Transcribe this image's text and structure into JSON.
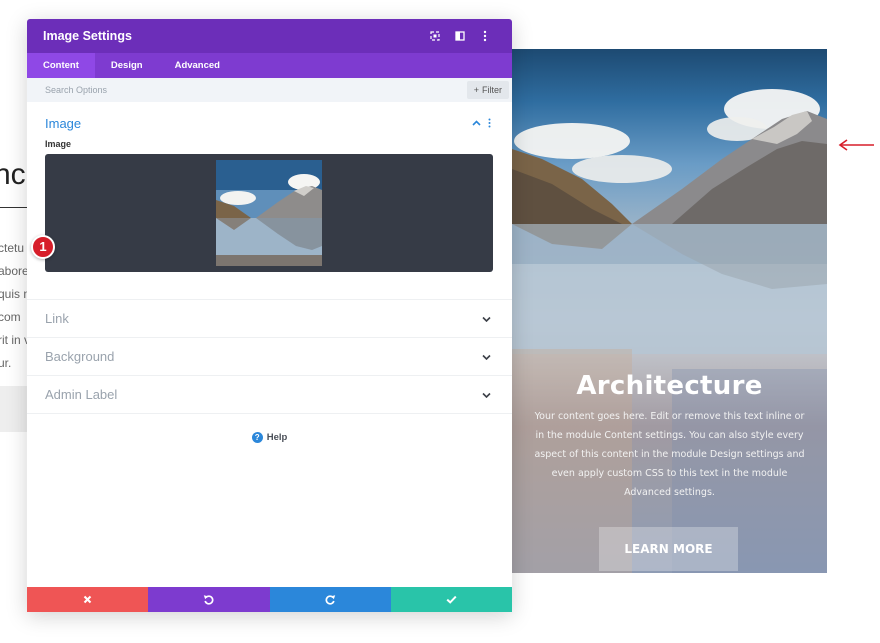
{
  "background_page": {
    "heading_fragment": "nc",
    "text_fragments": [
      "ctetu",
      "abore",
      "quis n",
      "com",
      "rit in v",
      "ur."
    ]
  },
  "hero": {
    "title": "Architecture",
    "body": "Your content goes here. Edit or remove this text inline or in the module Content settings. You can also style every aspect of this content in the module Design settings and even apply custom CSS to this text in the module Advanced settings.",
    "button_label": "LEARN MORE"
  },
  "modal": {
    "title": "Image Settings",
    "tabs": [
      {
        "label": "Content",
        "active": true
      },
      {
        "label": "Design",
        "active": false
      },
      {
        "label": "Advanced",
        "active": false
      }
    ],
    "search_placeholder": "Search Options",
    "filter_label": "Filter",
    "sections": {
      "image": {
        "title": "Image",
        "field_label": "Image",
        "badge": "1"
      },
      "link": {
        "title": "Link"
      },
      "background": {
        "title": "Background"
      },
      "admin_label": {
        "title": "Admin Label"
      }
    },
    "help_label": "Help"
  },
  "colors": {
    "header": "#6c2eb9",
    "tabs": "#7e3bd0",
    "accent_blue": "#2b87da",
    "cancel": "#ef5555",
    "undo": "#7d3bcf",
    "redo": "#2b87da",
    "save": "#29c4a9",
    "arrow": "#d71e2a"
  },
  "icons": {
    "header": [
      "expand-icon",
      "columns-icon",
      "more-vertical-icon"
    ],
    "footer": [
      "close-icon",
      "undo-icon",
      "redo-icon",
      "check-icon"
    ]
  }
}
